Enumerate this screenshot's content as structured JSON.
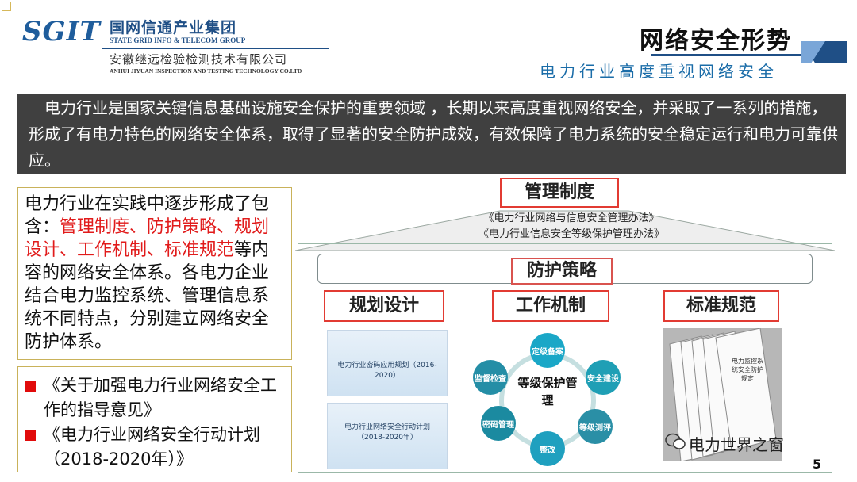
{
  "header": {
    "logo_mark": "SGIT",
    "logo_cn": "国网信通产业集团",
    "logo_en": "STATE GRID INFO & TELECOM GROUP",
    "logo_sub": "安徽继远检验检测技术有限公司",
    "logo_sub_en": "ANHUI JIYUAN INSPECTION AND TESTING TECHNOLOGY CO.LTD",
    "title": "网络安全形势",
    "subtitle": "电力行业高度重视网络安全"
  },
  "intro": {
    "text": "电力行业是国家关键信息基础设施安全保护的重要领域 ，长期以来高度重视网络安全，并采取了一系列的措施，形成了有电力特色的网络安全体系，取得了显著的安全防护成效，有效保障了电力系统的安全稳定运行和电力可靠供应。"
  },
  "left": {
    "p1": "电力行业在实践中逐步形成了包含：",
    "red": "管理制度、防护策略、规划设计、工作机制、标准规范",
    "p2": "等内容的网络安全体系。各电力企业结合电力监控系统、管理信息系统不同特点，分别建立网络安全防护体系。"
  },
  "docs_list": [
    "《关于加强电力行业网络安全工作的指导意见》",
    "《电力行业网络安全行动计划（2018-2020年）》"
  ],
  "diagram": {
    "management": "管理制度",
    "reg1": "《电力行业网络与信息安全管理办法》",
    "reg2": "《电力行业信息安全等级保护管理办法》",
    "protection": "防护策略",
    "planning": "规划设计",
    "mechanism": "工作机制",
    "standards": "标准规范",
    "doc1": "电力行业密码应用规划（2016-2020）",
    "doc2_l1": "电力行业网络安全行动计划",
    "doc2_l2": "（2018-2020年）",
    "cycle_center": "等级保护管理",
    "cycle_nodes": [
      "定级备案",
      "安全建设",
      "等级测评",
      "整改",
      "密码管理",
      "监督检查"
    ],
    "std_label": "电力监控系统安全防护规定"
  },
  "footer": {
    "watermark": "电力世界之窗",
    "page": "5"
  },
  "colors": {
    "brand_blue": "#1f4f86",
    "accent_red": "#e23b33",
    "banner_gray": "#404040"
  }
}
